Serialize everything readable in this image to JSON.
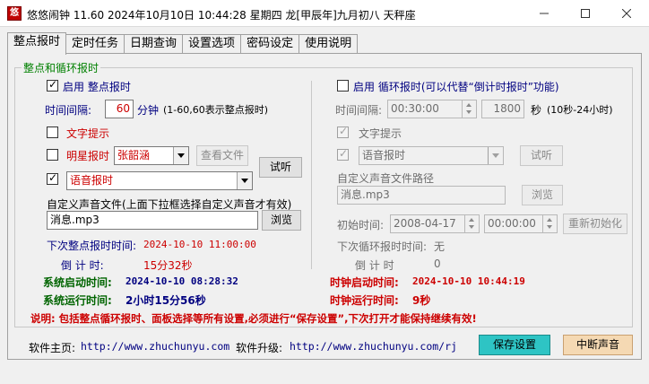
{
  "window": {
    "title": "悠悠闹钟 11.60 2024年10月10日 10:44:28 星期四 龙[甲辰年]九月初八 天秤座",
    "icon_text": "悠"
  },
  "tabs": [
    "整点报时",
    "定时任务",
    "日期查询",
    "设置选项",
    "密码设定",
    "使用说明"
  ],
  "group_title": "整点和循环报时",
  "left": {
    "enable_label": "启用 整点报时",
    "interval_label": "时间间隔:",
    "interval_value": "60",
    "interval_unit": "分钟",
    "interval_hint": "(1-60,60表示整点报时)",
    "text_tip_label": "文字提示",
    "star_label": "明星报时",
    "star_value": "张韶涵",
    "view_file_button": "查看文件",
    "voice_value": "语音报时",
    "try_button": "试听",
    "custom_file_label": "自定义声音文件(上面下拉框选择自定义声音才有效)",
    "custom_file_value": "消息.mp3",
    "browse_button": "浏览",
    "next_label": "下次整点报时时间:",
    "next_value": "2024-10-10 11:00:00",
    "countdown_label": "倒 计 时:",
    "countdown_value": "15分32秒",
    "sys_start_label": "系统启动时间:",
    "sys_start_value": "2024-10-10 08:28:32",
    "sys_run_label": "系统运行时间:",
    "sys_run_value": "2小时15分56秒"
  },
  "right": {
    "enable_label": "启用 循环报时(可以代替“倒计时报时”功能)",
    "interval_label": "时间间隔:",
    "interval_time": "00:30:00",
    "interval_seconds": "1800",
    "seconds_unit": "秒",
    "seconds_hint": "(10秒-24小时)",
    "text_tip_label": "文字提示",
    "voice_value": "语音报时",
    "try_button": "试听",
    "custom_path_label": "自定义声音文件路径",
    "custom_path_value": "消息.mp3",
    "browse_button": "浏览",
    "init_label": "初始时间:",
    "init_date": "2008-04-17",
    "init_time": "00:00:00",
    "reinit_button": "重新初始化",
    "next_label": "下次循环报时时间:",
    "next_value": "无",
    "countdown_label": "倒 计 时",
    "countdown_value": "0",
    "clock_start_label": "时钟启动时间:",
    "clock_start_value": "2024-10-10 10:44:19",
    "clock_run_label": "时钟运行时间:",
    "clock_run_value": "9秒"
  },
  "note": "说明: 包括整点循环报时、面板选择等所有设置,必须进行“保存设置”,下次打开才能保持继续有效!",
  "footer": {
    "home_label": "软件主页:",
    "home_url": "http://www.zhuchunyu.com",
    "upgrade_label": "软件升级:",
    "upgrade_url": "http://www.zhuchunyu.com/rj",
    "save_button": "保存设置",
    "stop_button": "中断声音"
  },
  "colors": {
    "blue_text": "#000080",
    "red_text": "#cc0000",
    "green_text": "#006400",
    "save_button_bg": "#2ec4c4",
    "stop_button_bg": "#f5d9b3"
  }
}
